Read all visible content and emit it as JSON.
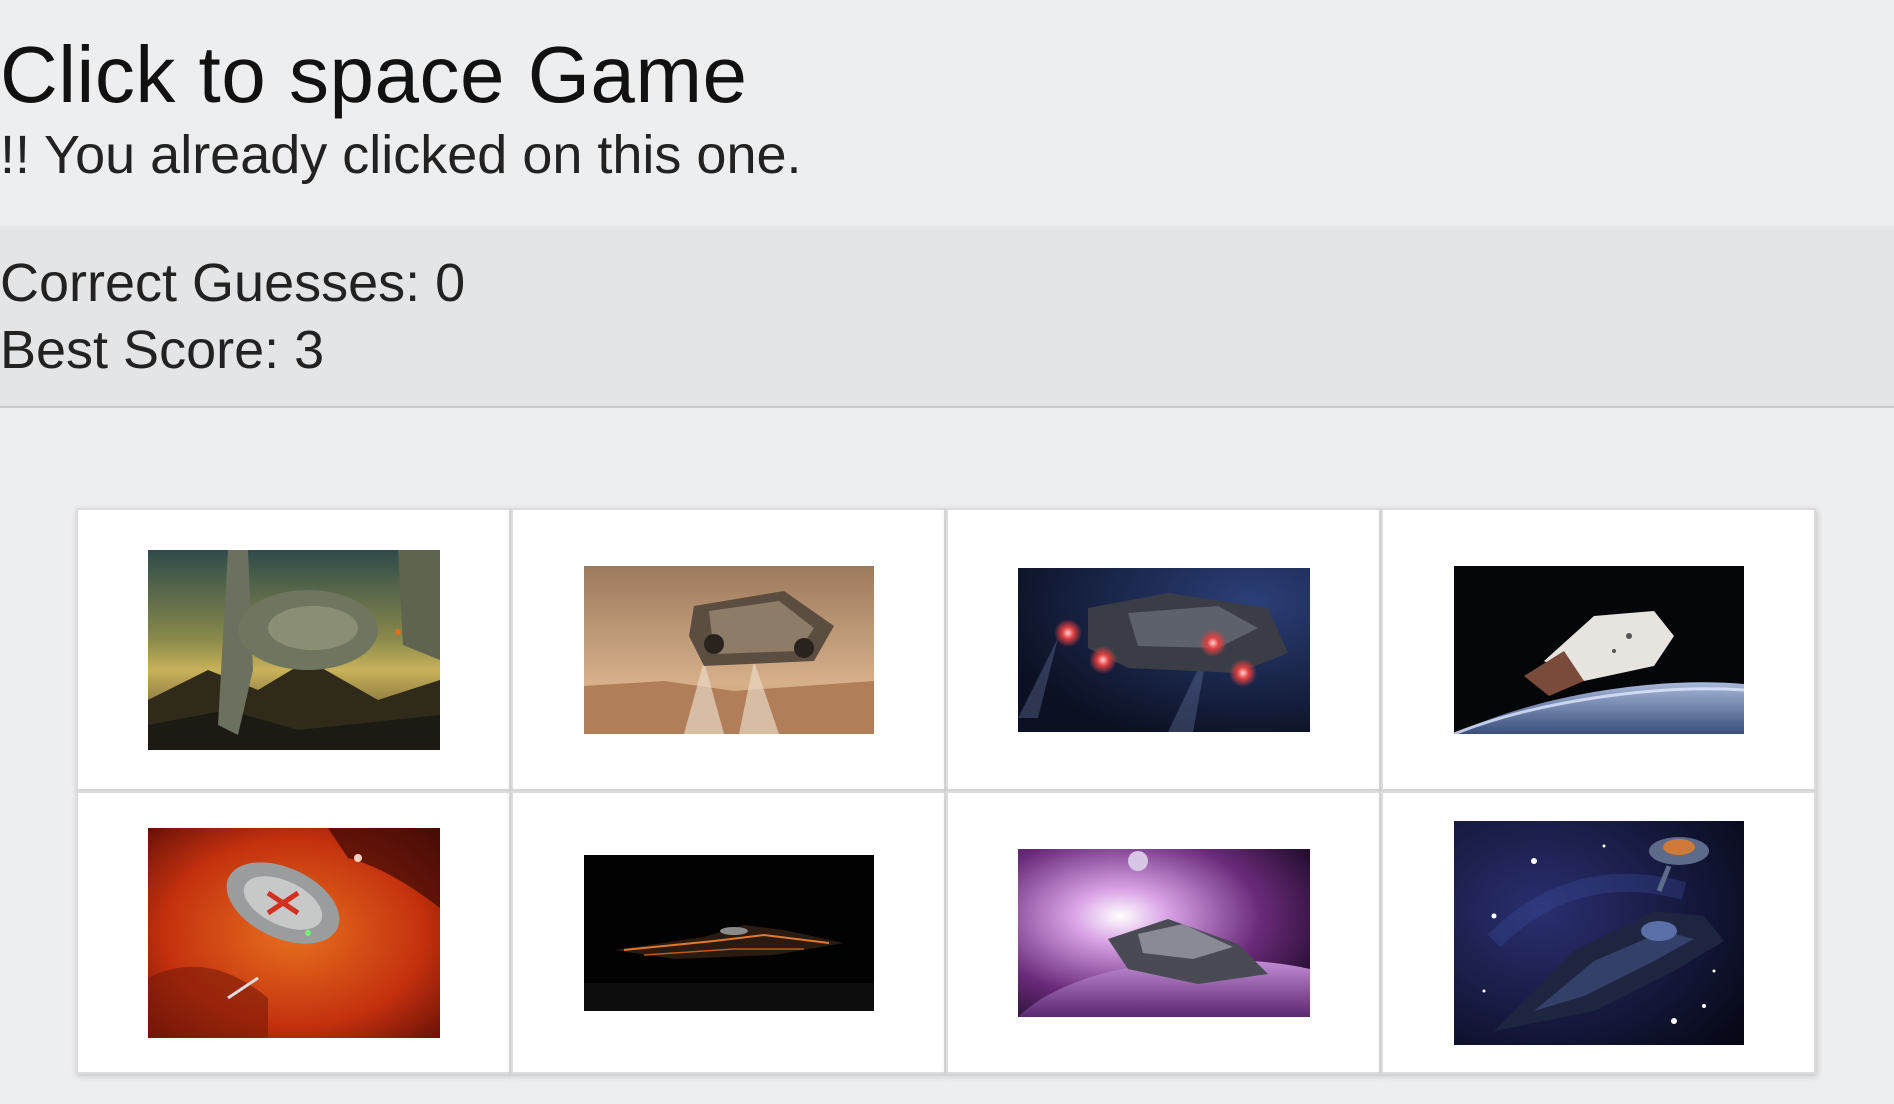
{
  "header": {
    "title": "Click to space Game",
    "message": "!! You already clicked on this one."
  },
  "score": {
    "correct": "Correct Guesses: 0",
    "best": "Best Score: 3"
  },
  "cards": [
    {
      "name": "space-freighter-over-cliffs-image"
    },
    {
      "name": "mars-lander-descending-image"
    },
    {
      "name": "gunship-with-thrusters-image"
    },
    {
      "name": "capsule-over-earth-image"
    },
    {
      "name": "saucer-station-red-nebula-image"
    },
    {
      "name": "sleek-ship-dark-image"
    },
    {
      "name": "ship-over-purple-planet-image"
    },
    {
      "name": "starship-with-saucer-image"
    }
  ]
}
